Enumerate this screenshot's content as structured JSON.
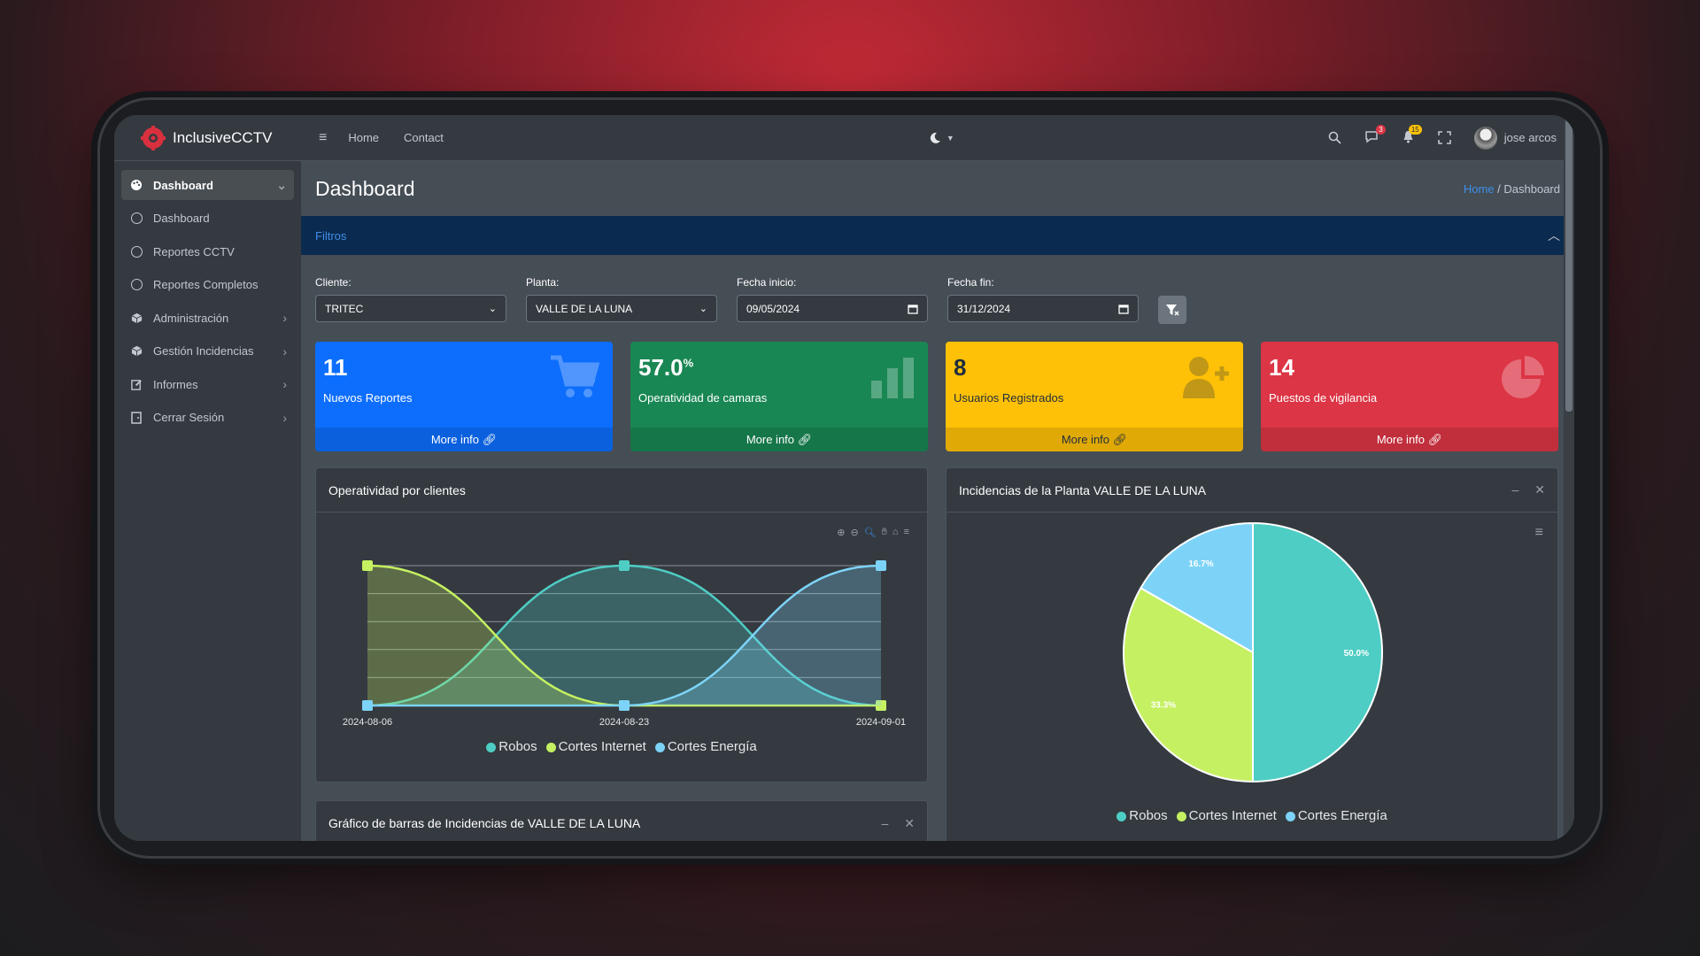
{
  "brand": {
    "name": "InclusiveCCTV"
  },
  "sidebar": {
    "items": [
      {
        "label": "Dashboard",
        "icon": "palette-icon",
        "active": true
      },
      {
        "label": "Dashboard",
        "icon": "circle-icon"
      },
      {
        "label": "Reportes CCTV",
        "icon": "circle-icon"
      },
      {
        "label": "Reportes Completos",
        "icon": "circle-icon"
      },
      {
        "label": "Administración",
        "icon": "cube-icon"
      },
      {
        "label": "Gestión Incidencias",
        "icon": "cube-icon"
      },
      {
        "label": "Informes",
        "icon": "edit-icon"
      },
      {
        "label": "Cerrar Sesión",
        "icon": "door-icon"
      }
    ]
  },
  "topbar": {
    "links": [
      "Home",
      "Contact"
    ],
    "badges": {
      "messages": "3",
      "notifications": "15"
    },
    "user": "jose arcos"
  },
  "page": {
    "title": "Dashboard",
    "breadcrumb": [
      "Home",
      "Dashboard"
    ]
  },
  "filters": {
    "title": "Filtros",
    "cliente_label": "Cliente:",
    "cliente_value": "TRITEC",
    "planta_label": "Planta:",
    "planta_value": "VALLE DE LA LUNA",
    "inicio_label": "Fecha inicio:",
    "inicio_value": "09/05/2024",
    "fin_label": "Fecha fin:",
    "fin_value": "31/12/2024"
  },
  "boxes": [
    {
      "value": "11",
      "label": "Nuevos Reportes",
      "footer": "More info",
      "color": "#0d6efd"
    },
    {
      "value": "57.0",
      "suffix": "%",
      "label": "Operatividad de camaras",
      "footer": "More info",
      "color": "#198754"
    },
    {
      "value": "8",
      "label": "Usuarios Registrados",
      "footer": "More info",
      "color": "#ffc107"
    },
    {
      "value": "14",
      "label": "Puestos de vigilancia",
      "footer": "More info",
      "color": "#dc3545"
    }
  ],
  "cards": {
    "area_title": "Operatividad por clientes",
    "pie_title": "Incidencias de la Planta VALLE DE LA LUNA",
    "bar_title": "Gráfico de barras de Incidencias de VALLE DE LA LUNA"
  },
  "chart_data": [
    {
      "type": "area",
      "title": "Operatividad por clientes",
      "x": [
        "2024-08-06",
        "2024-08-23",
        "2024-09-01"
      ],
      "ylim": [
        0,
        1
      ],
      "series": [
        {
          "name": "Robos",
          "values": [
            0,
            1,
            0
          ],
          "color": "#4ecdc4"
        },
        {
          "name": "Cortes Internet",
          "values": [
            1,
            0,
            0
          ],
          "color": "#c5f061"
        },
        {
          "name": "Cortes Energía",
          "values": [
            0,
            0,
            1
          ],
          "color": "#7dd3f7"
        }
      ],
      "legend": "bottom"
    },
    {
      "type": "pie",
      "title": "Incidencias de la Planta VALLE DE LA LUNA",
      "categories": [
        "Robos",
        "Cortes Internet",
        "Cortes Energía"
      ],
      "values": [
        50.0,
        33.3,
        16.7
      ],
      "labels": [
        "50.0%",
        "33.3%",
        "16.7%"
      ],
      "colors": [
        "#4ecdc4",
        "#c5f061",
        "#7dd3f7"
      ],
      "legend": "bottom"
    }
  ]
}
